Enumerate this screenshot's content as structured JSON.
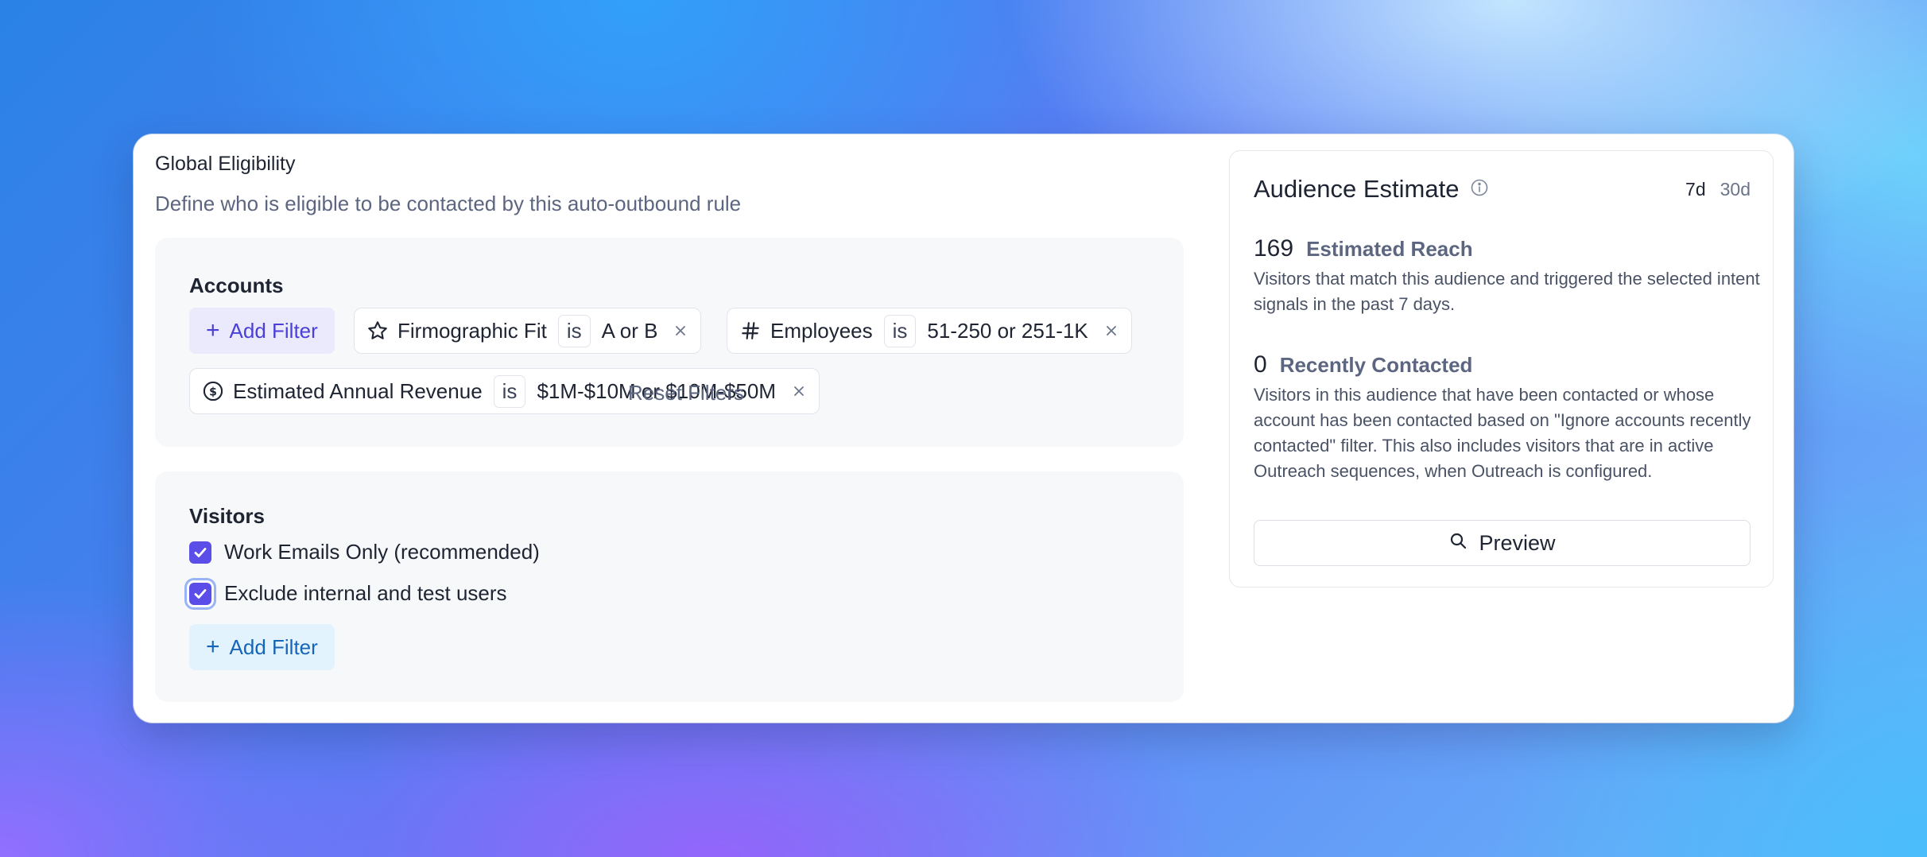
{
  "header": {
    "title": "Global Eligibility",
    "subtitle": "Define who is eligible to be contacted by this auto-outbound rule"
  },
  "accounts": {
    "heading": "Accounts",
    "add_filter_label": "Add Filter",
    "filters": [
      {
        "icon": "star-icon",
        "field": "Firmographic Fit",
        "operator": "is",
        "value": "A or B"
      },
      {
        "icon": "hash-icon",
        "field": "Employees",
        "operator": "is",
        "value": "51-250 or 251-1K"
      },
      {
        "icon": "dollar-circle-icon",
        "field": "Estimated Annual Revenue",
        "operator": "is",
        "value": "$1M-$10M or $10M-$50M"
      }
    ],
    "reset_label": "Reset Filters"
  },
  "visitors": {
    "heading": "Visitors",
    "options": [
      {
        "label": "Work Emails Only (recommended)",
        "checked": true
      },
      {
        "label": "Exclude internal and test users",
        "checked": true
      }
    ],
    "add_filter_label": "Add Filter"
  },
  "audience": {
    "title": "Audience Estimate",
    "ranges": [
      "7d",
      "30d"
    ],
    "selected_range": "7d",
    "estimated_reach": {
      "value": "169",
      "label": "Estimated Reach",
      "description": "Visitors that match this audience and triggered the selected intent signals in the past 7 days."
    },
    "recently_contacted": {
      "value": "0",
      "label": "Recently Contacted",
      "description": "Visitors in this audience that have been contacted or whose account has been contacted based on \"Ignore accounts recently contacted\" filter. This also includes visitors that are in active Outreach sequences, when Outreach is configured."
    },
    "preview_label": "Preview"
  },
  "colors": {
    "accent_purple": "#5b4ee8",
    "add_filter_purple_bg": "#ebeafd",
    "add_filter_blue_bg": "#e2f3fd",
    "muted_text": "#5d6680"
  }
}
